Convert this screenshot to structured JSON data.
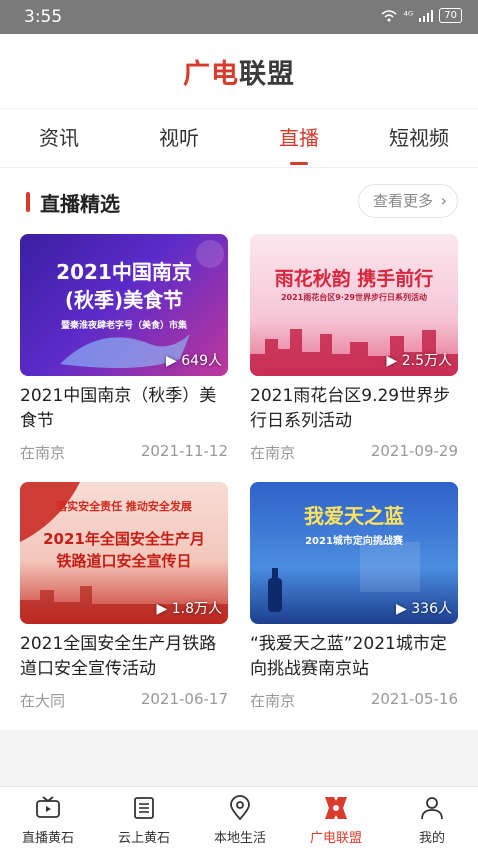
{
  "status_bar": {
    "time": "3:55",
    "signal_text": "⁴ᴳ",
    "battery": "70"
  },
  "header": {
    "logo_part1": "广电",
    "logo_part2": "联盟"
  },
  "tabs": [
    {
      "label": "资讯"
    },
    {
      "label": "视听"
    },
    {
      "label": "直播"
    },
    {
      "label": "短视频"
    }
  ],
  "section": {
    "title": "直播精选",
    "more_label": "查看更多"
  },
  "cards": [
    {
      "thumb_main": "2021中国南京\n(秋季)美食节",
      "thumb_sub": "暨秦淮夜肆老字号（美食）市集",
      "views": "649人",
      "title": "2021中国南京（秋季）美食节",
      "source": "在南京",
      "date": "2021-11-12"
    },
    {
      "thumb_main": "雨花秋韵 携手前行",
      "thumb_sub": "2021雨花台区9·29世界步行日系列活动",
      "views": "2.5万人",
      "title": "2021雨花台区9.29世界步行日系列活动",
      "source": "在南京",
      "date": "2021-09-29"
    },
    {
      "thumb_main": "2021年全国安全生产月\n铁路道口安全宣传日",
      "thumb_sub": "落实安全责任 推动安全发展",
      "views": "1.8万人",
      "title": "2021全国安全生产月铁路道口安全宣传活动",
      "source": "在大同",
      "date": "2021-06-17"
    },
    {
      "thumb_main": "我爱天之蓝",
      "thumb_sub": "2021城市定向挑战赛",
      "views": "336人",
      "title": "“我爱天之蓝”2021城市定向挑战赛南京站",
      "source": "在南京",
      "date": "2021-05-16"
    }
  ],
  "bottom_nav": [
    {
      "label": "直播黄石",
      "icon": "tv-icon"
    },
    {
      "label": "云上黄石",
      "icon": "document-icon"
    },
    {
      "label": "本地生活",
      "icon": "location-icon"
    },
    {
      "label": "广电联盟",
      "icon": "alliance-icon"
    },
    {
      "label": "我的",
      "icon": "user-icon"
    }
  ],
  "colors": {
    "accent": "#d93a2a"
  }
}
